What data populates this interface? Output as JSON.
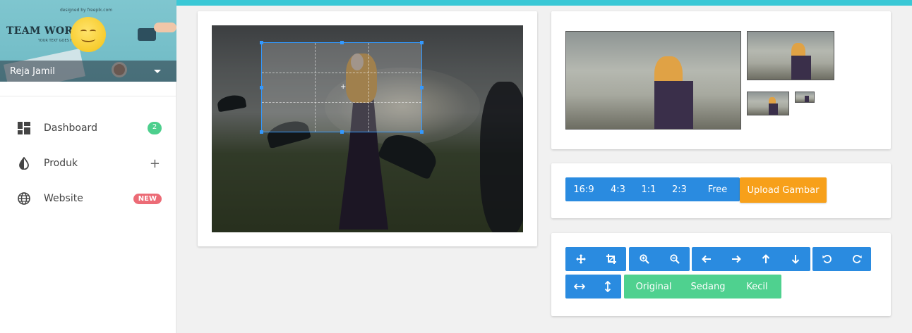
{
  "profile": {
    "credit_text": "designed by freepik.com",
    "banner_title": "TEAM WORK",
    "banner_subtitle": "YOUR TEXT GOES HERE",
    "user_name": "Reja Jamil"
  },
  "menu": [
    {
      "label": "Dashboard",
      "icon": "dashboard-icon",
      "badge": "2",
      "badge_color": "#4dcf8d"
    },
    {
      "label": "Produk",
      "icon": "contrast-icon",
      "action": "+"
    },
    {
      "label": "Website",
      "icon": "globe-icon",
      "badge": "NEW",
      "badge_color": "#ec6b76"
    }
  ],
  "ratio_buttons": [
    "16:9",
    "4:3",
    "1:1",
    "2:3",
    "Free"
  ],
  "upload_label": "Upload Gambar",
  "tools": {
    "group1": [
      "move-icon",
      "crop-icon"
    ],
    "group2": [
      "zoom-in-icon",
      "zoom-out-icon"
    ],
    "group3": [
      "arrow-left-icon",
      "arrow-right-icon",
      "arrow-up-icon",
      "arrow-down-icon"
    ],
    "group4": [
      "rotate-left-icon",
      "rotate-right-icon"
    ],
    "group5": [
      "flip-horizontal-icon",
      "flip-vertical-icon"
    ],
    "size_buttons": [
      "Original",
      "Sedang",
      "Kecil"
    ]
  },
  "colors": {
    "accent_blue": "#2a8be0",
    "upload_orange": "#f7a01a",
    "size_green": "#4fd18f",
    "top_bar": "#3ac8d6"
  }
}
